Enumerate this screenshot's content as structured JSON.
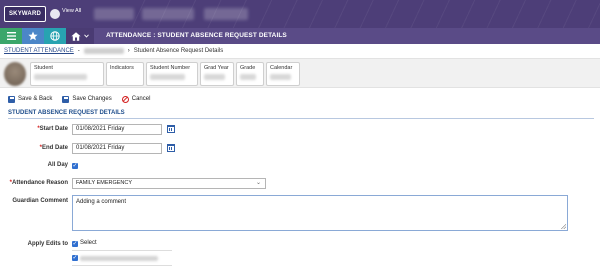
{
  "header": {
    "logo_text": "SKYWARD",
    "view_all_label": "View All"
  },
  "toolbar": {
    "title": "ATTENDANCE : STUDENT ABSENCE REQUEST DETAILS",
    "icons": [
      "hamburger-menu-icon",
      "star-icon",
      "globe-icon",
      "home-icon"
    ]
  },
  "breadcrumb": {
    "parent_label": "STUDENT ATTENDANCE",
    "current_label": "Student Absence Request Details"
  },
  "student_cards": {
    "student": "Student",
    "indicators": "Indicators",
    "student_number": "Student Number",
    "grad_year": "Grad Year",
    "grade": "Grade",
    "calendar": "Calendar"
  },
  "actions": {
    "save_back": "Save & Back",
    "save_changes": "Save Changes",
    "cancel": "Cancel"
  },
  "section": {
    "title": "STUDENT ABSENCE REQUEST DETAILS"
  },
  "form": {
    "start_date_label": "Start Date",
    "start_date_value": "01/08/2021 Friday",
    "end_date_label": "End Date",
    "end_date_value": "01/08/2021 Friday",
    "all_day_label": "All Day",
    "all_day_checked": true,
    "attendance_reason_label": "Attendance Reason",
    "attendance_reason_value": "FAMILY EMERGENCY",
    "guardian_comment_label": "Guardian Comment",
    "guardian_comment_value": "Adding a comment",
    "apply_edits_label": "Apply Edits to",
    "select_label": "Select",
    "required_marker": "*"
  },
  "colors": {
    "header_bg": "#4d3e78",
    "toolbar_bg": "#5a4b87",
    "menu_green": "#3aa66a",
    "fav_blue": "#4b86c8",
    "globe_teal": "#28a3b1",
    "section_blue": "#1f4e8c",
    "required_red": "#d32020",
    "checkbox_blue": "#2f6fd0"
  }
}
